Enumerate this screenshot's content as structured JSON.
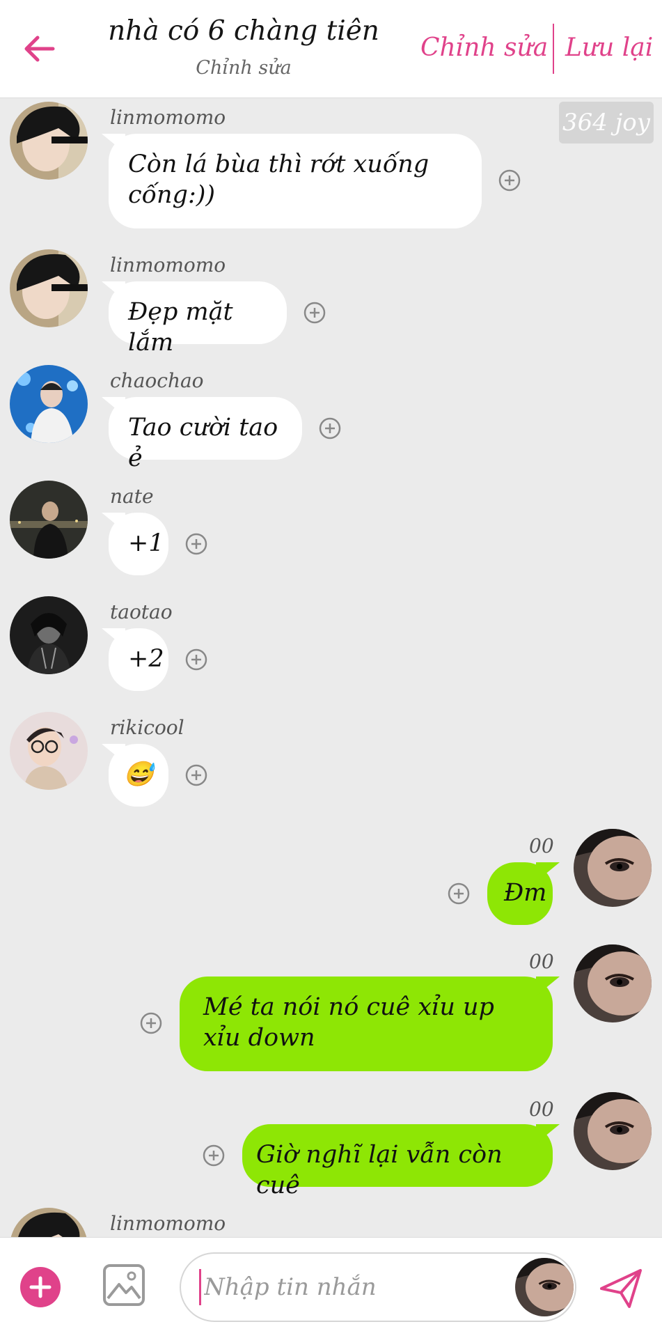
{
  "header": {
    "title": "nhà có 6 chàng tiên",
    "subtitle": "Chỉnh sửa",
    "edit_label": "Chỉnh sửa",
    "save_label": "Lưu lại",
    "accent_color": "#e0428a"
  },
  "badge": {
    "joy": "364 joy"
  },
  "messages": [
    {
      "sender": "linmomomo",
      "text": "Còn lá bùa thì rớt xuống cống:))",
      "side": "left",
      "avatar": "boy-dark-hair"
    },
    {
      "sender": "linmomomo",
      "text": "Đẹp mặt lắm",
      "side": "left",
      "avatar": "boy-dark-hair"
    },
    {
      "sender": "chaochao",
      "text": "Tao cười tao ẻ",
      "side": "left",
      "avatar": "boy-blue-background"
    },
    {
      "sender": "nate",
      "text": "+1",
      "side": "left",
      "avatar": "man-city-night"
    },
    {
      "sender": "taotao",
      "text": "+2",
      "side": "left",
      "avatar": "man-monochrome"
    },
    {
      "sender": "rikicool",
      "text": "😅",
      "side": "left",
      "avatar": "boy-glasses"
    },
    {
      "sender": "00",
      "text": "Đm",
      "side": "right",
      "avatar": "eye-closeup"
    },
    {
      "sender": "00",
      "text": "Mé ta nói nó cuê xỉu up xỉu down",
      "side": "right",
      "avatar": "eye-closeup"
    },
    {
      "sender": "00",
      "text": "Giờ nghĩ lại vẫn còn cuê",
      "side": "right",
      "avatar": "eye-closeup"
    },
    {
      "sender": "linmomomo",
      "text": "",
      "side": "left",
      "avatar": "boy-dark-hair"
    }
  ],
  "composer": {
    "placeholder": "Nhập tin nhắn",
    "add_icon": "plus-circle-icon",
    "image_icon": "image-icon",
    "send_icon": "send-icon"
  },
  "colors": {
    "outgoing_bubble": "#8ee605",
    "incoming_bubble": "#ffffff",
    "background": "#ebebeb"
  }
}
